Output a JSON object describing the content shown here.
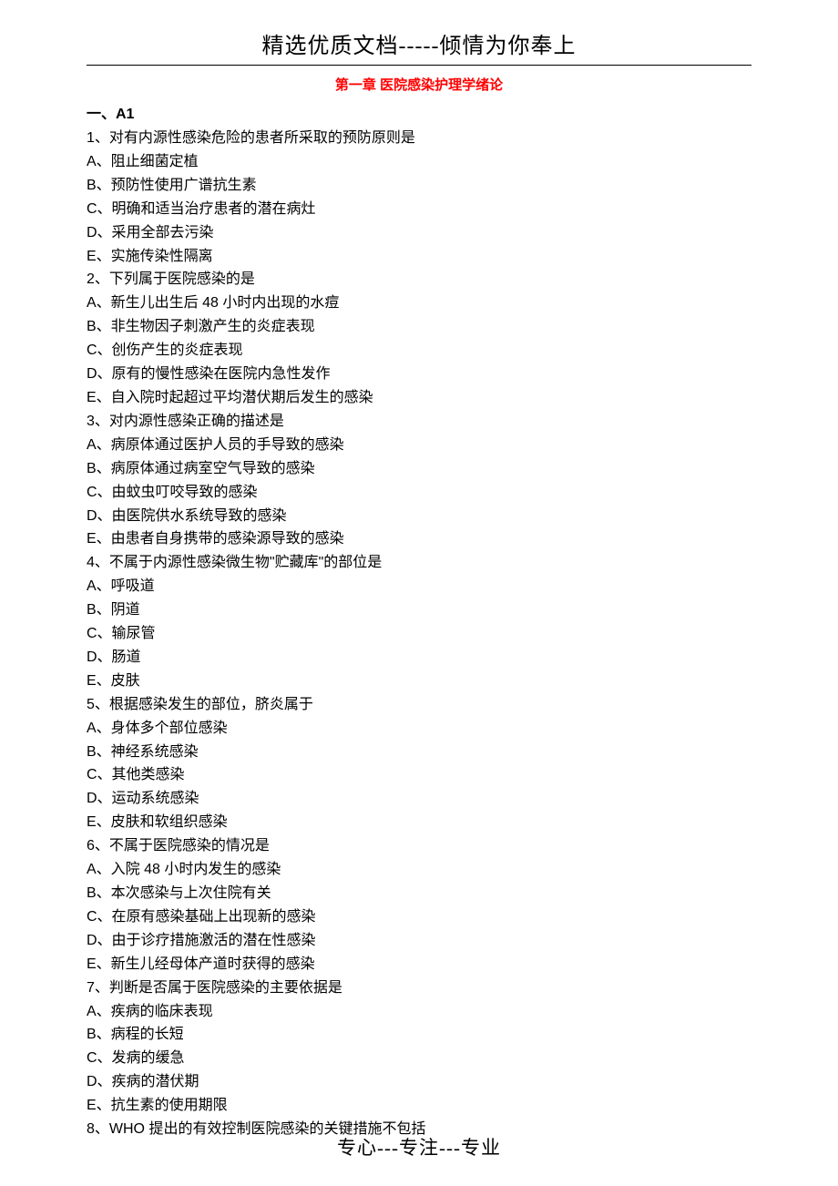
{
  "header": "精选优质文档-----倾情为你奉上",
  "chapter": "第一章  医院感染护理学绪论",
  "section": "一、A1",
  "lines": [
    "1、对有内源性感染危险的患者所采取的预防原则是",
    "A、阻止细菌定植",
    "B、预防性使用广谱抗生素",
    "C、明确和适当治疗患者的潜在病灶",
    "D、采用全部去污染",
    "E、实施传染性隔离",
    "2、下列属于医院感染的是",
    "A、新生儿出生后 48 小时内出现的水痘",
    "B、非生物因子刺激产生的炎症表现",
    "C、创伤产生的炎症表现",
    "D、原有的慢性感染在医院内急性发作",
    "E、自入院时起超过平均潜伏期后发生的感染",
    "3、对内源性感染正确的描述是",
    "A、病原体通过医护人员的手导致的感染",
    "B、病原体通过病室空气导致的感染",
    "C、由蚊虫叮咬导致的感染",
    "D、由医院供水系统导致的感染",
    "E、由患者自身携带的感染源导致的感染",
    "4、不属于内源性感染微生物\"贮藏库\"的部位是",
    "A、呼吸道",
    "B、阴道",
    "C、输尿管",
    "D、肠道",
    "E、皮肤",
    "5、根据感染发生的部位，脐炎属于",
    "A、身体多个部位感染",
    "B、神经系统感染",
    "C、其他类感染",
    "D、运动系统感染",
    "E、皮肤和软组织感染",
    "6、不属于医院感染的情况是",
    "A、入院 48 小时内发生的感染",
    "B、本次感染与上次住院有关",
    "C、在原有感染基础上出现新的感染",
    "D、由于诊疗措施激活的潜在性感染",
    "E、新生儿经母体产道时获得的感染",
    "7、判断是否属于医院感染的主要依据是",
    "A、疾病的临床表现",
    "B、病程的长短",
    "C、发病的缓急",
    "D、疾病的潜伏期",
    "E、抗生素的使用期限",
    "8、WHO 提出的有效控制医院感染的关键措施不包括"
  ],
  "footer": "专心---专注---专业"
}
